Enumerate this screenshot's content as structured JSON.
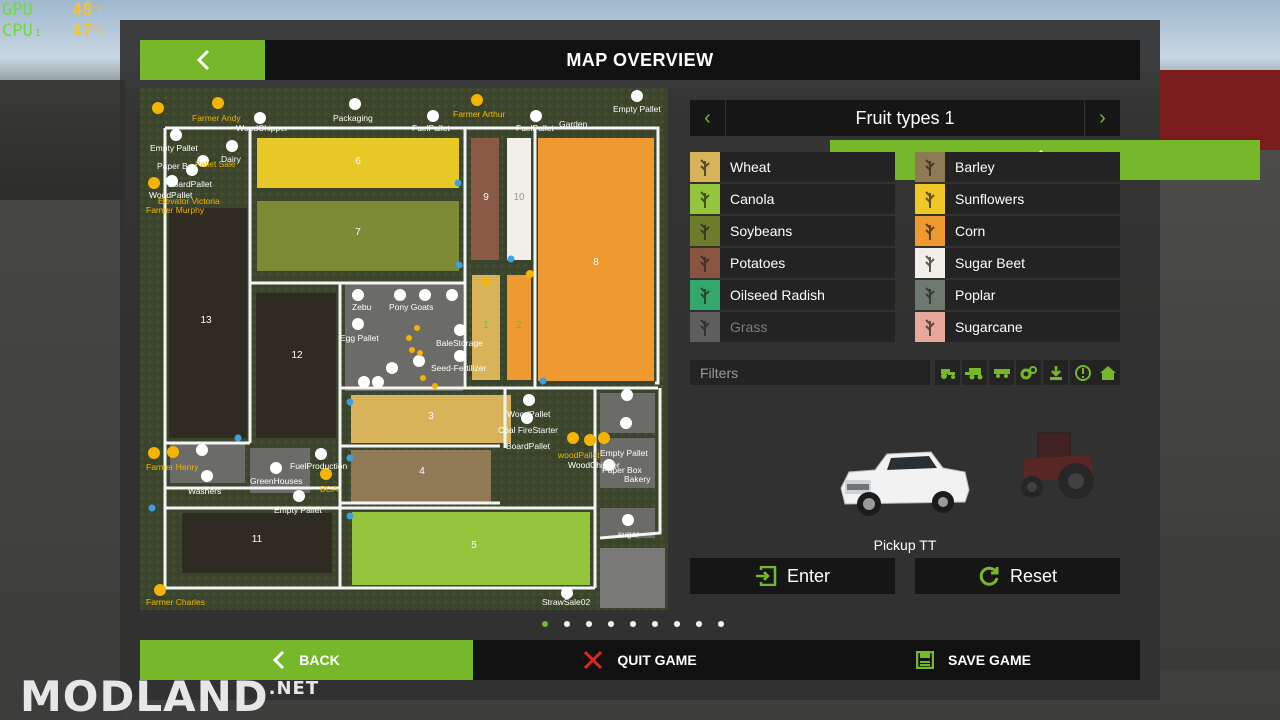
{
  "hud": {
    "gpu_label": "GPU",
    "gpu_value": "48",
    "gpu_unit": "°C",
    "cpu_label": "CPU₁",
    "cpu_value": "47",
    "cpu_unit": "°C"
  },
  "header": {
    "title": "MAP OVERVIEW",
    "prev_icon": "chevron-left-icon",
    "next_icon": "chevron-right-icon"
  },
  "map": {
    "field_numbers": [
      "6",
      "7",
      "9",
      "10",
      "8",
      "13",
      "12",
      "1",
      "2",
      "3",
      "4",
      "11",
      "5"
    ],
    "labels": {
      "farmer_andy": "Farmer Andy",
      "woodchipper": "WoodChipper",
      "packaging": "Packaging",
      "fuel_pallet_1": "FuelPallet",
      "farmer_arthur": "Farmer Arthur",
      "fuel_pallet_2": "FuelPallet",
      "garden": "Garden",
      "empty_pallet_top": "Empty Pallet",
      "empty_pallet_left": "Empty Pallet",
      "pallet_sale": "Pallet Sale",
      "paper_box": "Paper Box",
      "dairy": "Dairy",
      "board_pallet_left": "BoardPallet",
      "woodpallet_left": "WoodPallet",
      "elevator": "Elevator Victoria",
      "farmer_murphy": "Farmer Murphy",
      "zebu": "Zebu",
      "pony_goats": "Pony Goats",
      "egg_pallet": "Egg Pallet",
      "bale_storage": "BaleStorage",
      "seed_fertilizer": "Seed-Fertilizer",
      "woodpallet_mid": "WoodPallet",
      "coal_firestarter": "Coal FireStarter",
      "board_pallet_mid": "BoardPallet",
      "woodpallet_right": "woodPallet",
      "wood_chipper_right": "WoodChipper",
      "empty_pallet_right": "Empty Pallet",
      "paper_box_right": "Paper Box",
      "bakery": "Bakery",
      "farmer_henry": "Farmer Henry",
      "fuel_production": "FuelProduction",
      "greenhouses": "GreenHouses",
      "bga": "BGA",
      "washers": "Washers",
      "empty_pallet_bottom": "Empty Pallet",
      "sugar": "sugar",
      "farmer_charles": "Farmer Charles",
      "strawsale": "StrawSale02"
    }
  },
  "fruit_panel": {
    "title": "Fruit types  1",
    "fruits": [
      {
        "name": "Wheat",
        "color": "#d9b35a",
        "icon": "wheat-icon"
      },
      {
        "name": "Barley",
        "color": "#8f7a55",
        "icon": "barley-icon"
      },
      {
        "name": "Canola",
        "color": "#95c53d",
        "icon": "canola-icon"
      },
      {
        "name": "Sunflowers",
        "color": "#f0c825",
        "icon": "sunflower-icon"
      },
      {
        "name": "Soybeans",
        "color": "#6d7c2b",
        "icon": "soybean-icon"
      },
      {
        "name": "Corn",
        "color": "#ef9a2f",
        "icon": "corn-icon"
      },
      {
        "name": "Potatoes",
        "color": "#8a5540",
        "icon": "potato-icon"
      },
      {
        "name": "Sugar Beet",
        "color": "#f2eeea",
        "icon": "sugarbeet-icon"
      },
      {
        "name": "Oilseed Radish",
        "color": "#33a86a",
        "icon": "radish-icon"
      },
      {
        "name": "Poplar",
        "color": "#6e7a70",
        "icon": "poplar-icon"
      },
      {
        "name": "Grass",
        "color": "#5e5e5e",
        "icon": "grass-icon",
        "disabled": true
      },
      {
        "name": "Sugarcane",
        "color": "#e9a69a",
        "icon": "sugarcane-icon"
      }
    ]
  },
  "filters": {
    "label": "Filters",
    "icons": [
      "tractor-icon",
      "combine-icon",
      "trailer-icon",
      "tool-gear-icon",
      "download-icon",
      "warning-icon",
      "home-icon"
    ]
  },
  "vehicle": {
    "name": "Pickup TT",
    "secondary": "tractor"
  },
  "actions": {
    "enter": "Enter",
    "reset": "Reset"
  },
  "pagination": {
    "count": 9,
    "active": 0
  },
  "footer": {
    "back": "BACK",
    "quit": "QUIT GAME",
    "save": "SAVE GAME"
  },
  "colors": {
    "accent": "#76b82a",
    "panel": "#303030",
    "button_dark": "#161616"
  },
  "watermark": {
    "text": "MODLAND",
    "suffix": ".NET"
  }
}
